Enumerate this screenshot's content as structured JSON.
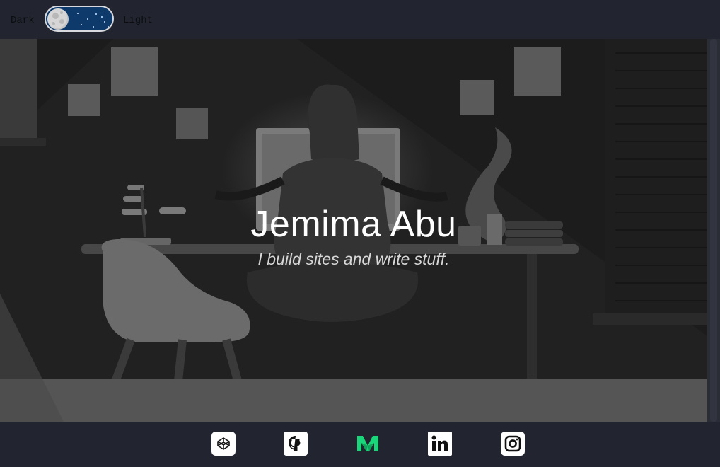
{
  "theme_switch": {
    "dark_label": "Dark",
    "light_label": "Light",
    "state": "dark",
    "icon": "moon-icon"
  },
  "hero": {
    "title": "Jemima Abu",
    "subtitle": "I build sites and write stuff."
  },
  "social_links": [
    {
      "name": "CodePen",
      "icon": "codepen-icon"
    },
    {
      "name": "GitHub",
      "icon": "github-icon"
    },
    {
      "name": "Medium",
      "icon": "medium-icon"
    },
    {
      "name": "LinkedIn",
      "icon": "linkedin-icon"
    },
    {
      "name": "Instagram",
      "icon": "instagram-icon"
    }
  ],
  "colors": {
    "background": "#22252f",
    "toggle_track": "#0d3a6b",
    "medium_green": "#1ad67a"
  }
}
